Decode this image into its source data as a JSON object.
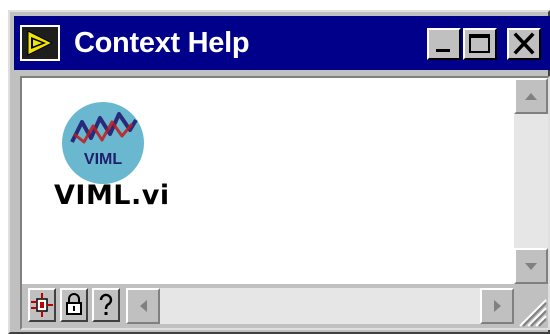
{
  "window": {
    "title": "Context Help",
    "icon": "labview-run-arrow-icon",
    "controls": {
      "minimize_icon": "minimize-icon",
      "maximize_icon": "maximize-icon",
      "close_icon": "close-icon"
    }
  },
  "content": {
    "vi_icon": {
      "name": "viml-vi-icon",
      "label": "VIML",
      "color": "#69b8cf"
    },
    "vi_name": "VIML.vi"
  },
  "toolbar": {
    "buttons": [
      {
        "name": "simple-diagram-help-icon"
      },
      {
        "name": "lock-icon"
      },
      {
        "name": "question-mark-icon"
      }
    ]
  },
  "colors": {
    "titlebar": "#00008b",
    "chrome": "#c0c0c0",
    "content_bg": "#ffffff"
  }
}
